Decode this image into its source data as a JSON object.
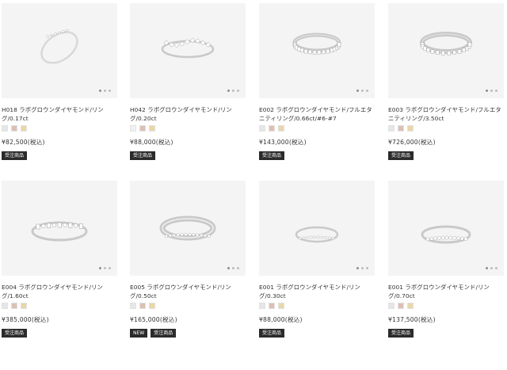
{
  "products": [
    {
      "title": "H018 ラボグロウンダイヤモンド/リング/0.17ct",
      "price": "¥82,500(税込)",
      "badges": [
        "受注商品"
      ],
      "swatches": [
        "#e6e6e6",
        "#dcc0b4",
        "#ead7a8"
      ],
      "ring": {
        "style": "thin-angled"
      }
    },
    {
      "title": "H042 ラボグロウンダイヤモンド/リング/0.20ct",
      "price": "¥88,000(税込)",
      "badges": [
        "受注商品"
      ],
      "swatches": [
        "#f1f1f1",
        "#dcc0b4",
        "#ead7a8"
      ],
      "ring": {
        "style": "cluster"
      }
    },
    {
      "title": "E002 ラボグロウンダイヤモンド/フルエタニティリング/0.66ct/#6-#7",
      "price": "¥143,000(税込)",
      "badges": [
        "受注商品"
      ],
      "swatches": [
        "#e6e6e6",
        "#dcc0b4",
        "#ead7a8"
      ],
      "ring": {
        "style": "full-eternity"
      }
    },
    {
      "title": "E003 ラボグロウンダイヤモンド/フルエタニティリング/3.50ct",
      "price": "¥726,000(税込)",
      "badges": [
        "受注商品"
      ],
      "swatches": [
        "#e6e6e6",
        "#dcc0b4",
        "#ead7a8"
      ],
      "ring": {
        "style": "full-eternity-large"
      }
    },
    {
      "title": "E004 ラボグロウンダイヤモンド/リング/1.60ct",
      "price": "¥385,000(税込)",
      "badges": [
        "受注商品"
      ],
      "swatches": [
        "#e6e6e6",
        "#dcc0b4",
        "#ead7a8"
      ],
      "ring": {
        "style": "baguette"
      }
    },
    {
      "title": "E005 ラボグロウンダイヤモンド/リング/0.50ct",
      "price": "¥165,000(税込)",
      "badges": [
        "NEW",
        "受注商品"
      ],
      "swatches": [
        "#e6e6e6",
        "#dcc0b4",
        "#ead7a8"
      ],
      "ring": {
        "style": "channel"
      }
    },
    {
      "title": "E001 ラボグロウンダイヤモンド/リング/0.30ct",
      "price": "¥88,000(税込)",
      "badges": [
        "受注商品"
      ],
      "swatches": [
        "#e6e6e6",
        "#dcc0b4",
        "#ead7a8"
      ],
      "ring": {
        "style": "half-eternity-thin"
      }
    },
    {
      "title": "E001 ラボグロウンダイヤモンド/リング/0.70ct",
      "price": "¥137,500(税込)",
      "badges": [
        "受注商品"
      ],
      "swatches": [
        "#e6e6e6",
        "#dcc0b4",
        "#ead7a8"
      ],
      "ring": {
        "style": "half-eternity"
      }
    }
  ],
  "carousel": {
    "dot_count": 3,
    "active_index": 0
  }
}
